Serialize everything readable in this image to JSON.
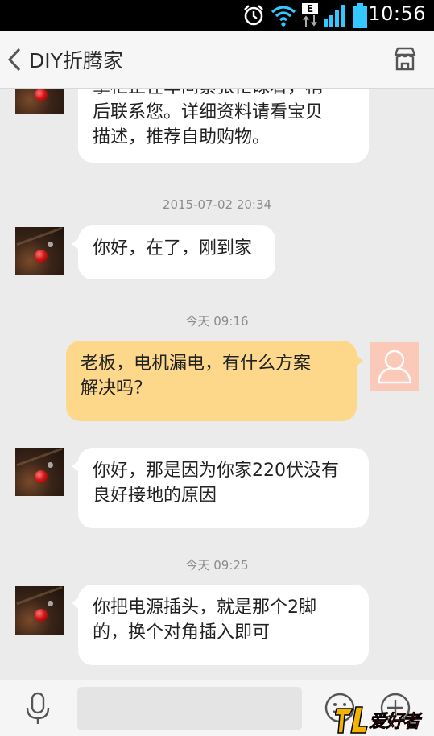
{
  "status_bar": {
    "time": "10:56",
    "icons": [
      "alarm-icon",
      "wifi-icon",
      "mobile-data-icon",
      "signal-icon",
      "battery-icon"
    ],
    "network_label": "E"
  },
  "header": {
    "title": "DIY折腾家",
    "back_icon": "chevron-left-icon",
    "store_icon": "store-icon"
  },
  "messages": [
    {
      "direction": "incoming",
      "lines": [
        "掌柜正在车间紧张忙碌着，稍",
        "后联系您。详细资料请看宝贝",
        "描述，推荐自助购物。"
      ],
      "partially_visible": true
    },
    {
      "type": "timestamp",
      "text": "2015-07-02 20:34"
    },
    {
      "direction": "incoming",
      "lines": [
        "你好，在了，刚到家"
      ]
    },
    {
      "type": "timestamp",
      "text": "今天 09:16"
    },
    {
      "direction": "outgoing",
      "lines": [
        "老板，电机漏电，有什么方案",
        "解决吗？"
      ]
    },
    {
      "direction": "incoming",
      "lines": [
        "你好，那是因为你家220伏没有",
        "良好接地的原因"
      ]
    },
    {
      "type": "timestamp",
      "text": "今天 09:25"
    },
    {
      "direction": "incoming",
      "lines": [
        "你把电源插头，就是那个2脚",
        "的，换个对角插入即可"
      ]
    }
  ],
  "input_bar": {
    "input_value": "",
    "icons": [
      "microphone-icon",
      "emoji-icon",
      "plus-icon"
    ]
  },
  "watermark": {
    "text": "爱好者"
  },
  "colors": {
    "header_bg": "#f6f6f6",
    "chat_bg": "#ebebeb",
    "incoming_bubble": "#ffffff",
    "outgoing_bubble": "#fdd78a",
    "user_avatar": "#fac9b8"
  }
}
